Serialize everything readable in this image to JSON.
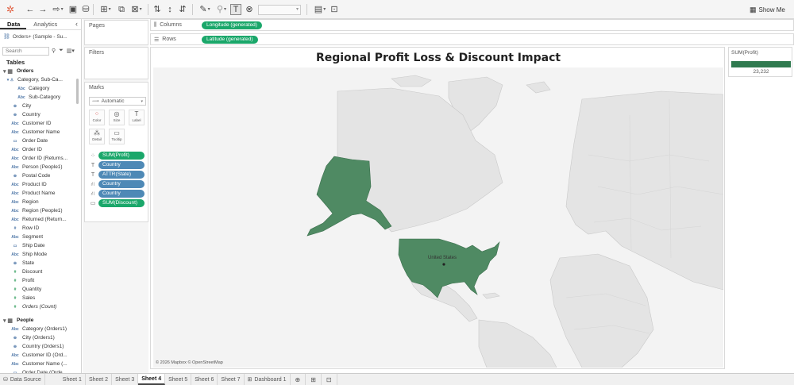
{
  "toolbar": {
    "icons": [
      "tableau-logo-icon",
      "undo-icon",
      "redo-icon",
      "replay-icon",
      "save-icon",
      "new-datasource-icon",
      "new-worksheet-icon",
      "duplicate-icon",
      "clear-icon",
      "swap-icon",
      "sort-ascending-icon",
      "sort-descending-icon",
      "highlight-icon",
      "group-icon",
      "show-labels-icon",
      "fix-axes-icon",
      "fit-dropdown-icon",
      "show-cards-icon",
      "presentation-icon"
    ],
    "show_me_label": "Show Me"
  },
  "data_pane": {
    "tabs": [
      "Data",
      "Analytics"
    ],
    "datasource": "Orders+ (Sample - Su...",
    "search_placeholder": "Search",
    "tables_header": "Tables",
    "fields": [
      {
        "label": "Orders",
        "kind": "table",
        "icon": "▾ ▦"
      },
      {
        "label": "Category, Sub-Ca...",
        "kind": "hier",
        "icon": "▾ ♙"
      },
      {
        "label": "Category",
        "kind": "dim2",
        "icon": "Abc"
      },
      {
        "label": "Sub-Category",
        "kind": "dim2",
        "icon": "Abc"
      },
      {
        "label": "City",
        "kind": "dim",
        "icon": "⊕"
      },
      {
        "label": "Country",
        "kind": "dim",
        "icon": "⊕"
      },
      {
        "label": "Customer ID",
        "kind": "dim",
        "icon": "Abc"
      },
      {
        "label": "Customer Name",
        "kind": "dim",
        "icon": "Abc"
      },
      {
        "label": "Order Date",
        "kind": "dim",
        "icon": "▭"
      },
      {
        "label": "Order ID",
        "kind": "dim",
        "icon": "Abc"
      },
      {
        "label": "Order ID (Returns...",
        "kind": "dim",
        "icon": "Abc"
      },
      {
        "label": "Person (People1)",
        "kind": "dim",
        "icon": "Abc"
      },
      {
        "label": "Postal Code",
        "kind": "dim",
        "icon": "⊕"
      },
      {
        "label": "Product ID",
        "kind": "dim",
        "icon": "Abc"
      },
      {
        "label": "Product Name",
        "kind": "dim",
        "icon": "Abc"
      },
      {
        "label": "Region",
        "kind": "dim",
        "icon": "Abc"
      },
      {
        "label": "Region (People1)",
        "kind": "dim",
        "icon": "Abc"
      },
      {
        "label": "Returned (Return...",
        "kind": "dim",
        "icon": "Abc"
      },
      {
        "label": "Row ID",
        "kind": "dim",
        "icon": "#"
      },
      {
        "label": "Segment",
        "kind": "dim",
        "icon": "Abc"
      },
      {
        "label": "Ship Date",
        "kind": "dim",
        "icon": "▭"
      },
      {
        "label": "Ship Mode",
        "kind": "dim",
        "icon": "Abc"
      },
      {
        "label": "State",
        "kind": "dim",
        "icon": "⊕"
      },
      {
        "label": "Discount",
        "kind": "measure",
        "icon": "#"
      },
      {
        "label": "Profit",
        "kind": "measure",
        "icon": "#"
      },
      {
        "label": "Quantity",
        "kind": "measure",
        "icon": "#"
      },
      {
        "label": "Sales",
        "kind": "measure",
        "icon": "#"
      },
      {
        "label": "Orders (Count)",
        "kind": "measure-italic",
        "icon": "#"
      },
      {
        "label": "",
        "kind": "spacer",
        "icon": ""
      },
      {
        "label": "People",
        "kind": "table",
        "icon": "▾ ▦"
      },
      {
        "label": "Category (Orders1)",
        "kind": "dim",
        "icon": "Abc"
      },
      {
        "label": "City (Orders1)",
        "kind": "dim",
        "icon": "⊕"
      },
      {
        "label": "Country (Orders1)",
        "kind": "dim",
        "icon": "⊕"
      },
      {
        "label": "Customer ID (Ord...",
        "kind": "dim",
        "icon": "Abc"
      },
      {
        "label": "Customer Name (...",
        "kind": "dim",
        "icon": "Abc"
      },
      {
        "label": "Order Date (Orde...",
        "kind": "dim",
        "icon": "▭"
      }
    ]
  },
  "cards": {
    "pages_title": "Pages",
    "filters_title": "Filters",
    "marks_title": "Marks",
    "mark_type": "Automatic",
    "mark_buttons": [
      "Color",
      "Size",
      "Label",
      "Detail",
      "Tooltip"
    ],
    "mark_pills": [
      {
        "label": "SUM(Profit)",
        "color": "green",
        "icon": "⁘"
      },
      {
        "label": "Country",
        "color": "blue",
        "icon": "T"
      },
      {
        "label": "ATTR(State)",
        "color": "blue",
        "icon": "T"
      },
      {
        "label": "Country",
        "color": "blue",
        "icon": "⛙"
      },
      {
        "label": "Country",
        "color": "blue",
        "icon": "⛙"
      },
      {
        "label": "SUM(Discount)",
        "color": "green",
        "icon": "▭"
      }
    ]
  },
  "shelves": {
    "columns_label": "Columns",
    "columns_pill": "Longitude (generated)",
    "rows_label": "Rows",
    "rows_pill": "Latitude (generated)"
  },
  "view": {
    "title": "Regional Profit Loss & Discount Impact",
    "country_label": "United States",
    "attribution": "© 2026 Mapbox © OpenStreetMap"
  },
  "legend": {
    "title": "SUM(Profit)",
    "value": "23,232",
    "color": "#2f7a4f"
  },
  "bottom_tabs": {
    "datasource": "Data Source",
    "sheets": [
      "Sheet 1",
      "Sheet 2",
      "Sheet 3",
      "Sheet 4",
      "Sheet 5",
      "Sheet 6",
      "Sheet 7"
    ],
    "active_sheet": "Sheet 4",
    "dashboard": "Dashboard 1"
  },
  "colors": {
    "accent_green": "#1aa76a",
    "pill_blue": "#4e89b6",
    "map_fill": "#4f8a63"
  }
}
